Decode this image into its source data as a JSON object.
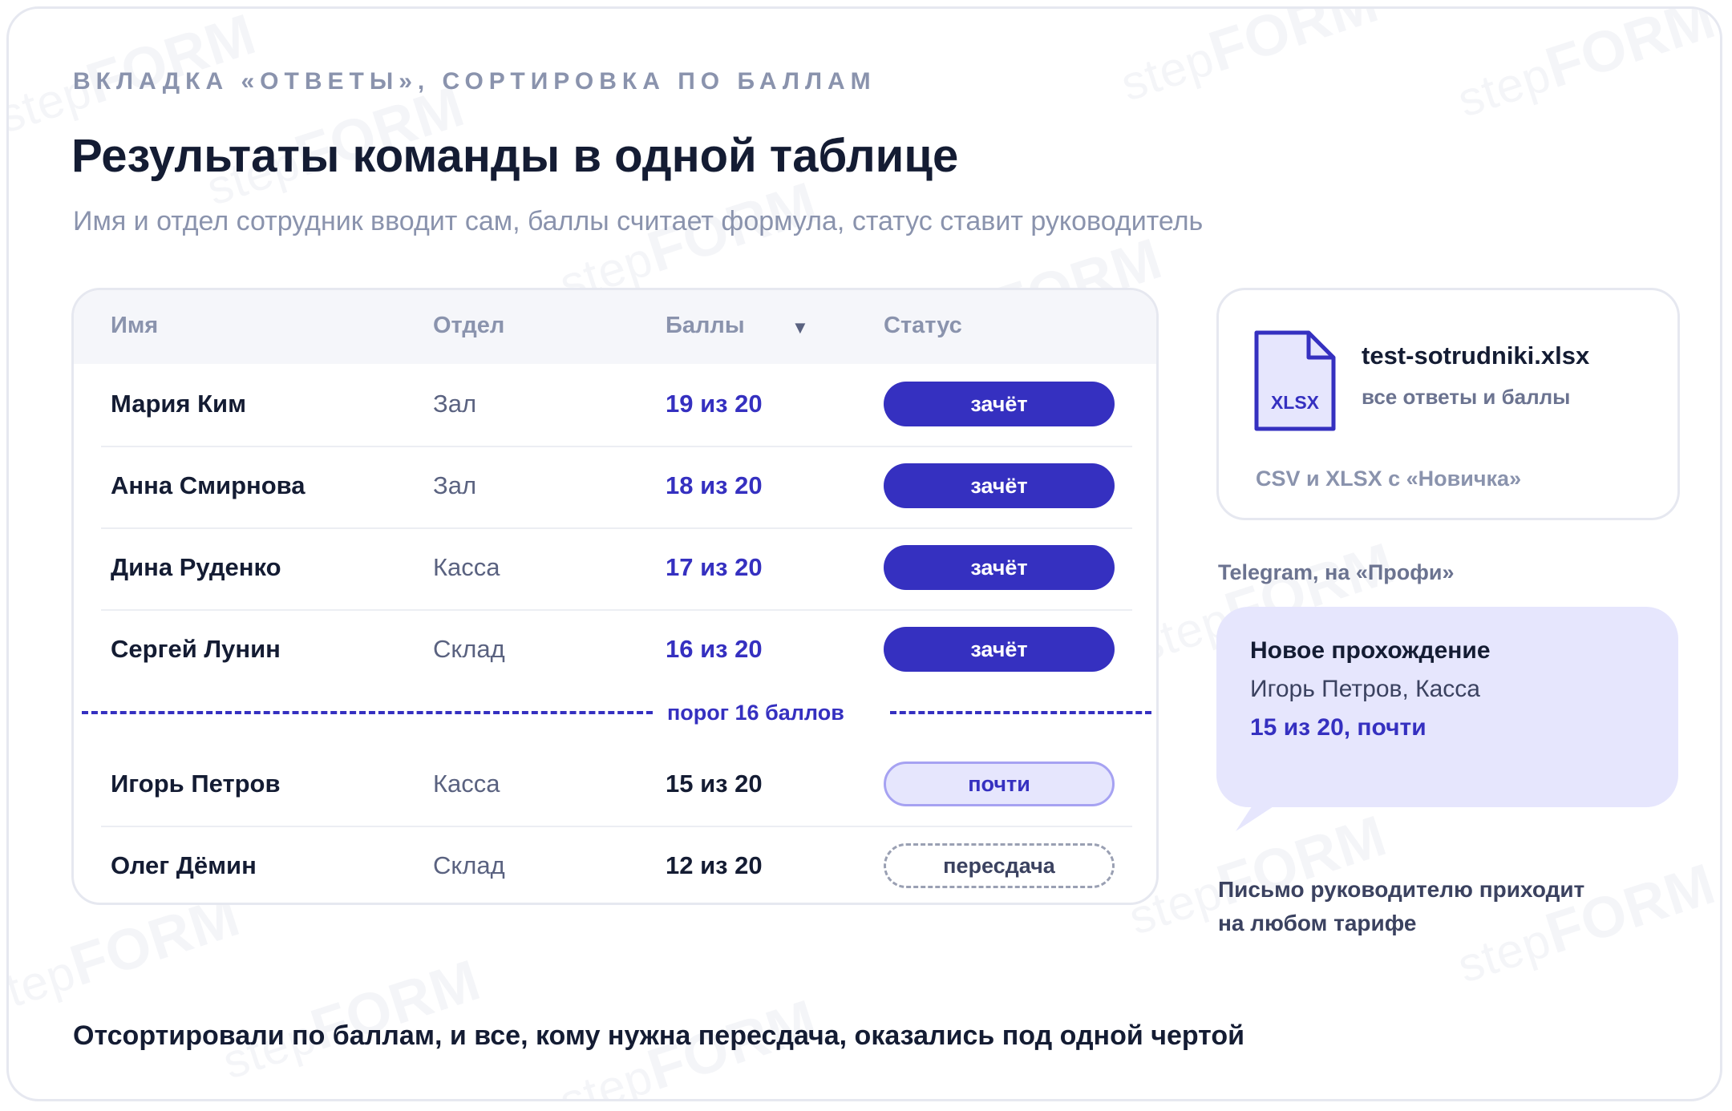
{
  "header": {
    "eyebrow": "ВКЛАДКА «ОТВЕТЫ», СОРТИРОВКА ПО БАЛЛАМ",
    "title": "Результаты команды в одной таблице",
    "subtitle": "Имя и отдел сотрудник вводит сам, баллы считает формула, статус ставит руководитель"
  },
  "table": {
    "columns": {
      "name": "Имя",
      "department": "Отдел",
      "score": "Баллы",
      "status": "Статус"
    },
    "sort_indicator": "▼",
    "rows": [
      {
        "name": "Мария Ким",
        "department": "Зал",
        "score": "19 из 20",
        "status": "зачёт"
      },
      {
        "name": "Анна Смирнова",
        "department": "Зал",
        "score": "18 из 20",
        "status": "зачёт"
      },
      {
        "name": "Дина Руденко",
        "department": "Касса",
        "score": "17 из 20",
        "status": "зачёт"
      },
      {
        "name": "Сергей Лунин",
        "department": "Склад",
        "score": "16 из 20",
        "status": "зачёт"
      },
      {
        "name": "Игорь Петров",
        "department": "Касса",
        "score": "15 из 20",
        "status": "почти"
      },
      {
        "name": "Олег Дёмин",
        "department": "Склад",
        "score": "12 из 20",
        "status": "пересдача"
      }
    ],
    "threshold_label": "порог 16 баллов"
  },
  "export": {
    "icon_label": "XLSX",
    "file_name": "test-sotrudniki.xlsx",
    "description": "все ответы и баллы",
    "note": "CSV и XLSX с «Новичка»"
  },
  "telegram": {
    "caption": "Telegram, на «Профи»",
    "title": "Новое прохождение",
    "line": "Игорь Петров, Касса",
    "score": "15 из 20, почти"
  },
  "mail_note": "Письмо руководителю приходит на любом тарифе",
  "footer": "Отсортировали по баллам, и все, кому нужна пересдача, оказались под одной чертой",
  "watermark": {
    "prefix": "step",
    "brand": "FORM"
  },
  "colors": {
    "accent": "#3530c0",
    "accent_light": "#e6e6fd",
    "muted": "#8a93ad",
    "text": "#141c33"
  },
  "icons": [
    "xlsx-file-icon",
    "sort-down-icon"
  ]
}
